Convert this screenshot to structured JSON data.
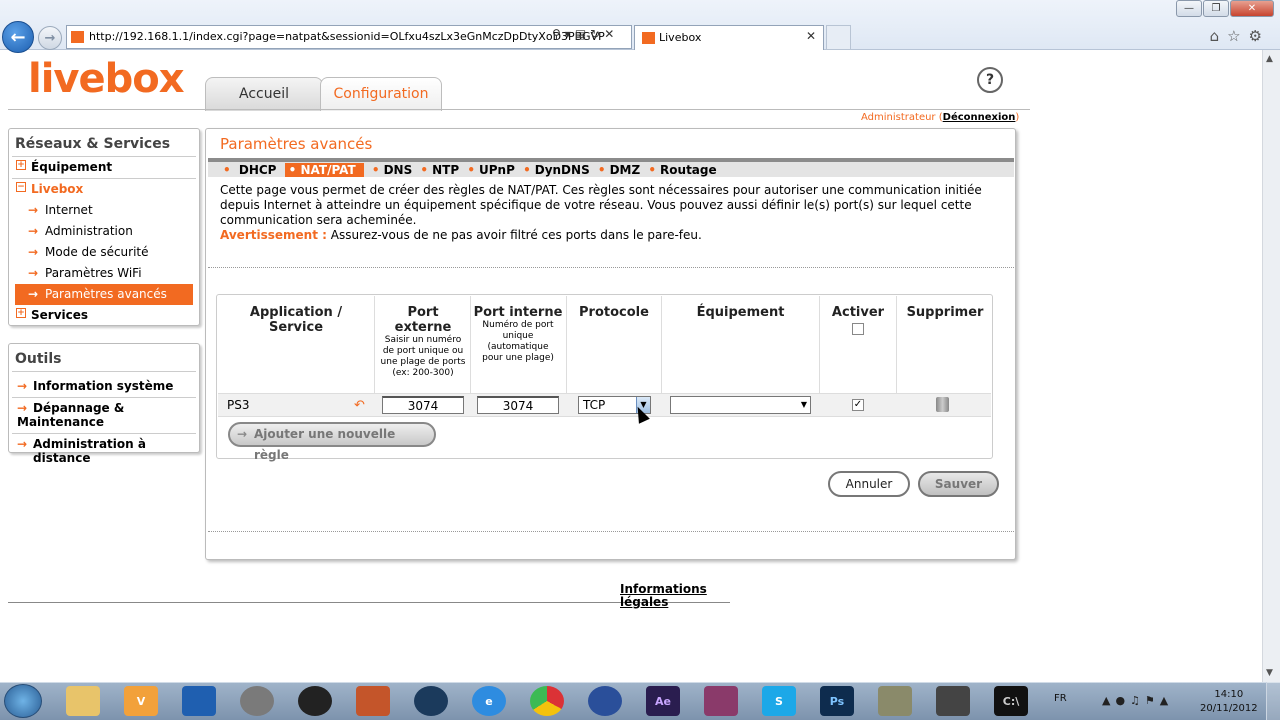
{
  "browser": {
    "url": "http://192.168.1.1/index.cgi?page=natpat&sessionid=OLfxu4szLx3eGnMczDpDtyXoD3PBGVP",
    "tab_title": "Livebox",
    "window_controls": [
      "minimize",
      "restore",
      "close"
    ]
  },
  "header": {
    "logo": "livebox",
    "tabs": [
      "Accueil",
      "Configuration"
    ],
    "active_tab": "Configuration",
    "help": "?",
    "user_label": "Administrateur",
    "logout": "Déconnexion"
  },
  "sidebar": {
    "section1_title": "Réseaux & Services",
    "items": [
      {
        "label": "Équipement"
      },
      {
        "label": "Livebox"
      },
      {
        "label": "Internet"
      },
      {
        "label": "Administration"
      },
      {
        "label": "Mode de sécurité"
      },
      {
        "label": "Paramètres WiFi"
      },
      {
        "label": "Paramètres avancés"
      },
      {
        "label": "Services"
      }
    ],
    "section2_title": "Outils",
    "tools": [
      {
        "label": "Information système"
      },
      {
        "label": "Dépannage & Maintenance"
      },
      {
        "label": "Administration à distance"
      }
    ]
  },
  "main": {
    "title": "Paramètres avancés",
    "subnav": [
      "DHCP",
      "NAT/PAT",
      "DNS",
      "NTP",
      "UPnP",
      "DynDNS",
      "DMZ",
      "Routage"
    ],
    "active_subnav": "NAT/PAT",
    "description": "Cette page vous permet de créer des règles de NAT/PAT. Ces règles sont nécessaires pour autoriser une communication initiée depuis Internet à atteindre un équipement spécifique de votre réseau. Vous pouvez aussi définir le(s) port(s) sur lequel cette communication sera acheminée.",
    "warning_label": "Avertissement :",
    "warning_text": "Assurez-vous de ne pas avoir filtré ces ports dans le pare-feu."
  },
  "table": {
    "headers": {
      "app": "Application / Service",
      "port_ext": "Port externe",
      "port_ext_hint": "Saisir un numéro de port unique ou une plage de ports (ex: 200-300)",
      "port_int": "Port interne",
      "port_int_hint": "Numéro de port unique (automatique pour une plage)",
      "proto": "Protocole",
      "equip": "Équipement",
      "active": "Activer",
      "delete": "Supprimer"
    },
    "rows": [
      {
        "app": "PS3",
        "port_ext": "3074",
        "port_int": "3074",
        "proto": "TCP",
        "equip": "",
        "active": true
      }
    ],
    "add_rule": "Ajouter une nouvelle règle"
  },
  "actions": {
    "cancel": "Annuler",
    "save": "Sauver"
  },
  "footer": {
    "legal": "Informations légales"
  },
  "taskbar": {
    "lang": "FR",
    "time": "14:10",
    "date": "20/11/2012",
    "apps": [
      "explorer",
      "vlc",
      "app3",
      "app4",
      "app5",
      "app6",
      "app7",
      "ie",
      "chrome",
      "app10",
      "after-effects",
      "winrar",
      "skype",
      "photoshop",
      "app15",
      "app16",
      "cmd"
    ]
  },
  "colors": {
    "accent": "#f26a21"
  }
}
